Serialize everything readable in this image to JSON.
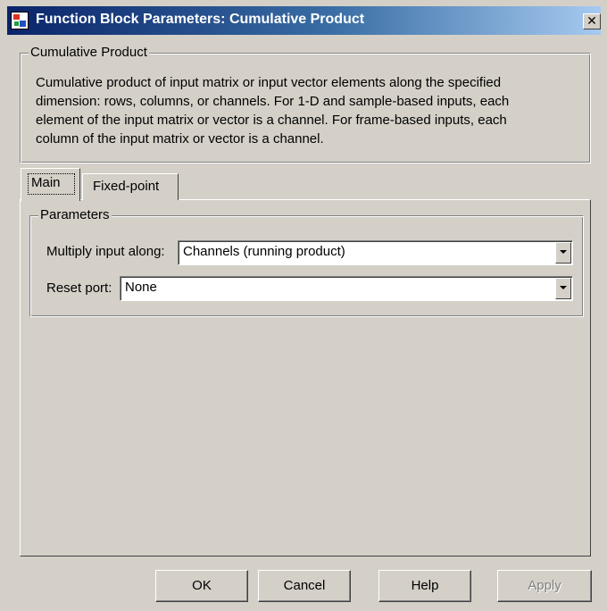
{
  "window": {
    "title": "Function Block Parameters: Cumulative Product",
    "close_glyph": "✕"
  },
  "block": {
    "group_title": "Cumulative Product",
    "description_lines": [
      "Cumulative product of input matrix or input vector elements along the specified",
      "dimension: rows, columns, or channels.  For 1-D and sample-based inputs, each",
      "element of the input matrix or vector is a channel.  For frame-based inputs, each",
      "column of the input matrix or vector is a channel."
    ]
  },
  "tabs": [
    {
      "label": "Main",
      "selected": true
    },
    {
      "label": "Fixed-point",
      "selected": false
    }
  ],
  "parameters": {
    "group_title": "Parameters",
    "multiply_label": "Multiply input along:",
    "multiply_value": "Channels (running product)",
    "reset_label": "Reset port:",
    "reset_value": "None"
  },
  "buttons": {
    "ok": "OK",
    "cancel": "Cancel",
    "help": "Help",
    "apply": "Apply"
  },
  "icons": {
    "app": "simulink-block-icon",
    "close": "close-icon",
    "dropdown": "chevron-down-icon"
  },
  "colors": {
    "face": "#d4d0c8",
    "title_start": "#0a246a",
    "title_end": "#a6caf0",
    "disabled_text": "#808080"
  }
}
